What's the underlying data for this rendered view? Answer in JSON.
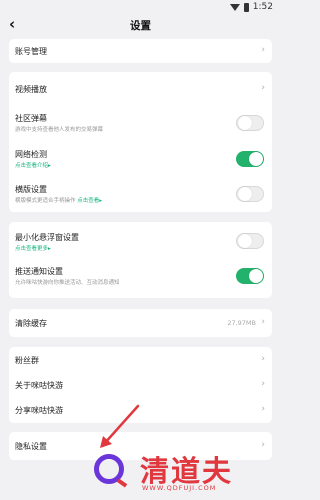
{
  "status_bar": {
    "time": "1:52"
  },
  "header": {
    "title": "设置"
  },
  "account": {
    "label": "账号管理"
  },
  "section1": {
    "video": {
      "label": "视频播放"
    },
    "danmaku": {
      "label": "社区弹幕",
      "desc": "游戏中支持查看他人发布的交易弹幕",
      "enabled": false
    },
    "network": {
      "label": "网络检测",
      "link": "点击查看介绍",
      "enabled": true
    },
    "landscape": {
      "label": "横版设置",
      "desc": "横版模式更适合手柄操作",
      "link": "点击查看",
      "enabled": false
    }
  },
  "section2": {
    "floating": {
      "label": "最小化悬浮窗设置",
      "link": "点击查看更多",
      "enabled": false
    },
    "push": {
      "label": "推送通知设置",
      "desc": "允许咪咕快游向你推送活动、互动消息通知",
      "enabled": true
    }
  },
  "cache": {
    "label": "清除缓存",
    "value": "27.97MB"
  },
  "section3": {
    "fans": {
      "label": "粉丝群"
    },
    "about": {
      "label": "关于咪咕快游"
    },
    "share": {
      "label": "分享咪咕快游"
    }
  },
  "privacy": {
    "label": "隐私设置"
  },
  "watermark": {
    "brand": "清道夫",
    "url": "WWW.QDFUJI.COM"
  },
  "colors": {
    "accent_green": "#22b26b",
    "watermark_red": "#e0383e",
    "watermark_purple": "#6a35d9",
    "background": "#f1f1f3"
  }
}
